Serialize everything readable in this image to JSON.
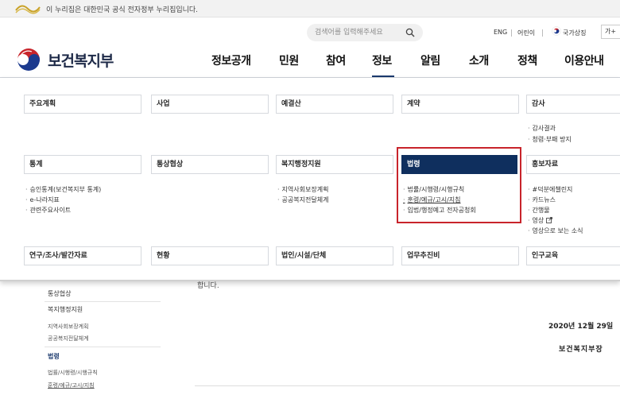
{
  "gov_bar": {
    "text": "이 누리집은 대한민국 공식 전자정부 누리집입니다.",
    "logo_icon": "korea-government-wave-logo"
  },
  "header": {
    "search_placeholder": "검색어를 입력해주세요",
    "utility_links": [
      "ENG",
      "어린이",
      "국가상징"
    ],
    "font_button": "가+",
    "logo_text": "보건복지부",
    "nav": [
      "정보공개",
      "민원",
      "참여",
      "정보",
      "알림",
      "소개",
      "정책",
      "이용안내"
    ],
    "active_nav": "정보"
  },
  "mega_menu": {
    "row1": [
      {
        "title": "주요계획",
        "items": []
      },
      {
        "title": "사업",
        "items": []
      },
      {
        "title": "예결산",
        "items": []
      },
      {
        "title": "계약",
        "items": []
      },
      {
        "title": "감사",
        "items": [
          "감사결과",
          "청렴·부패 방지"
        ]
      }
    ],
    "row2": [
      {
        "title": "통계",
        "items": [
          "승인통계(보건복지부 통계)",
          "e-나라지표",
          "관련주요사이트"
        ]
      },
      {
        "title": "통상협상",
        "items": []
      },
      {
        "title": "복지행정지원",
        "items": [
          "지역사회보장계획",
          "공공복지전달체계"
        ]
      },
      {
        "title": "법령",
        "items": [
          "법률/시행령/시행규칙",
          "훈령/예규/고시/지침",
          "입법/행정예고 전자공청회"
        ],
        "active": true
      },
      {
        "title": "홍보자료",
        "items": [
          "#덕분에챌린지",
          "카드뉴스",
          "간행물",
          "영상",
          "영상으로 보는 소식"
        ]
      }
    ],
    "row3": [
      {
        "title": "연구/조사/발간자료"
      },
      {
        "title": "현황"
      },
      {
        "title": "법인/시설/단체"
      },
      {
        "title": "업무추진비"
      },
      {
        "title": "인구교육"
      }
    ]
  },
  "background_page": {
    "lnb": {
      "items": [
        "통상협상",
        "복지행정지원",
        "법령"
      ],
      "welfare_sub": [
        "지역사회보장계획",
        "공공복지전달체계"
      ],
      "law_sub": [
        "법률/시행령/시행규칙",
        "훈령/예규/고시/지침"
      ]
    },
    "body_fragment": "합니다.",
    "date": "2020년 12월 29일",
    "signature": "보건복지부장"
  },
  "colors": {
    "active_menu_bg": "#0f2f5e",
    "highlight_border": "#c8242b",
    "logo_text": "#1e2a48"
  }
}
